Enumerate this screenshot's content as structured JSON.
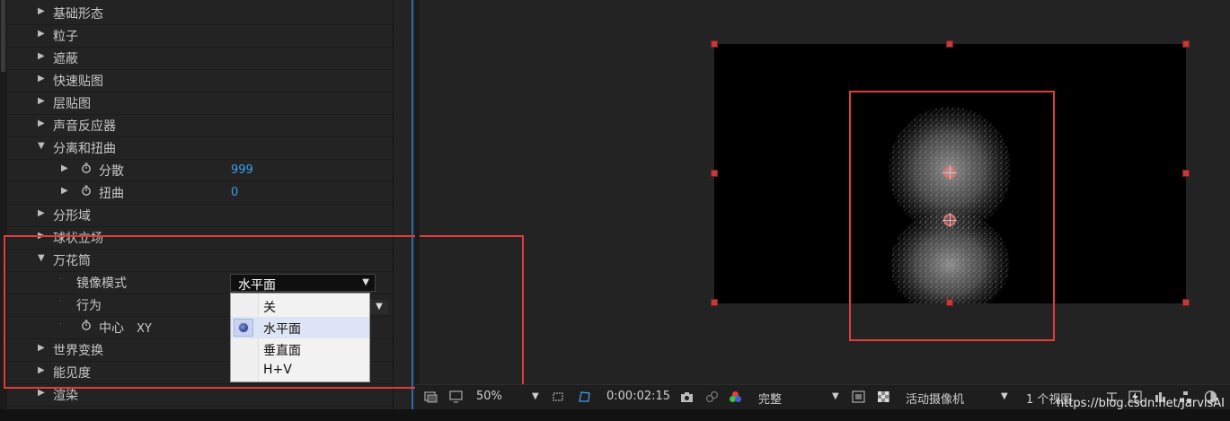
{
  "effect_panel": {
    "groups": [
      {
        "label": "基础形态",
        "expanded": false
      },
      {
        "label": "粒子",
        "expanded": false
      },
      {
        "label": "遮蔽",
        "expanded": false
      },
      {
        "label": "快速贴图",
        "expanded": false
      },
      {
        "label": "层贴图",
        "expanded": false
      },
      {
        "label": "声音反应器",
        "expanded": false
      },
      {
        "label": "分离和扭曲",
        "expanded": true
      },
      {
        "label": "分形域",
        "expanded": false
      },
      {
        "label": "球状立场",
        "expanded": false
      },
      {
        "label": "万花筒",
        "expanded": true
      },
      {
        "label": "世界变换",
        "expanded": false
      },
      {
        "label": "能见度",
        "expanded": false
      },
      {
        "label": "渲染",
        "expanded": false
      }
    ],
    "split_distort": {
      "scatter": {
        "label": "分散",
        "value": "999"
      },
      "twist": {
        "label": "扭曲",
        "value": "0"
      }
    },
    "kaleidoscope": {
      "mirror_mode": {
        "label": "镜像模式",
        "value": "水平面"
      },
      "behavior": {
        "label": "行为"
      },
      "center": {
        "label": "中心",
        "unit": "XY"
      }
    }
  },
  "dropdown": {
    "options": [
      "关",
      "水平面",
      "垂直面",
      "H+V"
    ],
    "selected_index": 1
  },
  "viewer_toolbar": {
    "zoom": "50%",
    "timecode": "0:00:02:15",
    "resolution": "完整",
    "camera": "活动摄像机",
    "views": "1 个视图"
  },
  "watermark": "https://blog.csdn.net/JarvisAI",
  "colors": {
    "accent_blue": "#3d9ee6",
    "highlight_red": "#e03c3c",
    "handle_red": "#c23b3b"
  }
}
